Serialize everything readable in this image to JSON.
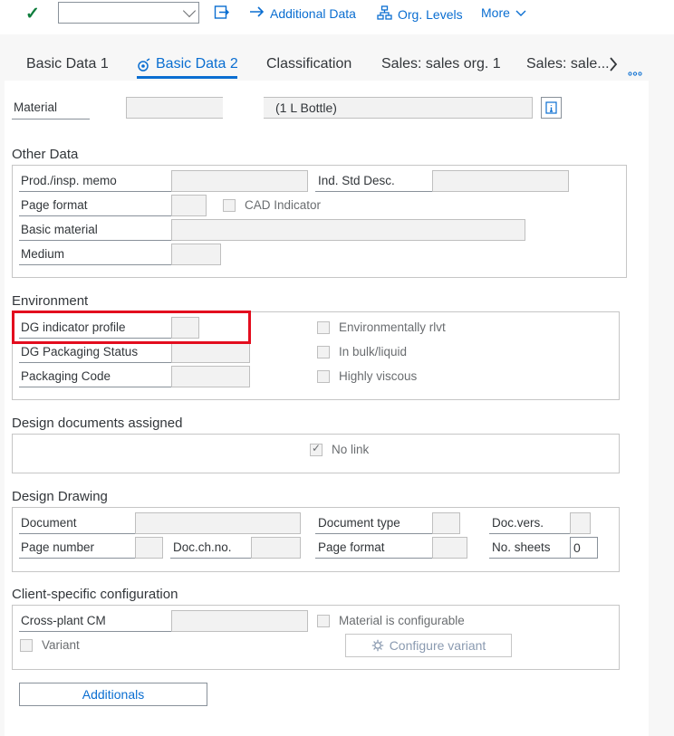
{
  "toolbar": {
    "additional_data": "Additional Data",
    "org_levels": "Org. Levels",
    "more": "More"
  },
  "tabs": [
    {
      "label": "Basic Data 1"
    },
    {
      "label": "Basic Data 2"
    },
    {
      "label": "Classification"
    },
    {
      "label": "Sales: sales org. 1"
    },
    {
      "label": "Sales: sale..."
    }
  ],
  "material": {
    "label": "Material",
    "description": "(1 L Bottle)"
  },
  "other_data": {
    "title": "Other Data",
    "prod_insp_memo": "Prod./insp. memo",
    "ind_std_desc": "Ind. Std Desc.",
    "page_format": "Page format",
    "cad_indicator": "CAD Indicator",
    "basic_material": "Basic material",
    "medium": "Medium"
  },
  "environment": {
    "title": "Environment",
    "dg_indicator_profile": "DG indicator profile",
    "dg_packaging_status": "DG Packaging Status",
    "packaging_code": "Packaging Code",
    "environmentally_rlvt": "Environmentally rlvt",
    "in_bulk_liquid": "In bulk/liquid",
    "highly_viscous": "Highly viscous"
  },
  "design_documents": {
    "title": "Design documents assigned",
    "no_link": "No link"
  },
  "design_drawing": {
    "title": "Design Drawing",
    "document": "Document",
    "document_type": "Document type",
    "doc_vers": "Doc.vers.",
    "page_number": "Page number",
    "doc_ch_no": "Doc.ch.no.",
    "page_format": "Page format",
    "no_sheets": "No. sheets",
    "no_sheets_value": "0"
  },
  "client_config": {
    "title": "Client-specific configuration",
    "cross_plant_cm": "Cross-plant CM",
    "material_configurable": "Material is configurable",
    "variant": "Variant",
    "configure_variant": "Configure variant"
  },
  "additionals_button": "Additionals"
}
